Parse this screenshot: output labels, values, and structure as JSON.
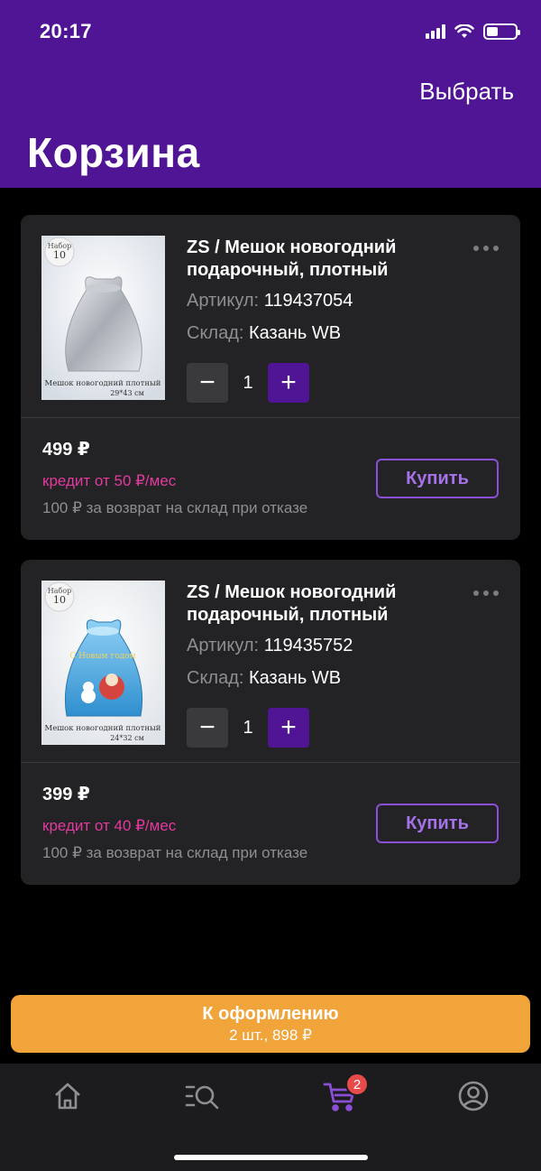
{
  "status": {
    "time": "20:17"
  },
  "header": {
    "action": "Выбрать",
    "title": "Корзина"
  },
  "products": [
    {
      "title": "ZS / Мешок новогодний подарочный, плотный",
      "article_label": "Артикул:",
      "article": "119437054",
      "warehouse_label": "Склад:",
      "warehouse": "Казань WB",
      "quantity": "1",
      "price": "499 ₽",
      "credit": "кредит от 50 ₽/мес",
      "refund": "100 ₽ за возврат на склад при отказе",
      "buy_label": "Купить",
      "image": {
        "badge": "Набор 10 штук",
        "caption": "Мешок новогодний плотный",
        "size": "29*43 см",
        "color": "#b9bec6"
      }
    },
    {
      "title": "ZS / Мешок новогодний подарочный, плотный",
      "article_label": "Артикул:",
      "article": "119435752",
      "warehouse_label": "Склад:",
      "warehouse": "Казань WB",
      "quantity": "1",
      "price": "399 ₽",
      "credit": "кредит от 40 ₽/мес",
      "refund": "100 ₽ за возврат на склад при отказе",
      "buy_label": "Купить",
      "image": {
        "badge": "Набор 10 штук",
        "caption": "Мешок новогодний плотный",
        "size": "24*32 см",
        "color": "#5fb2e6"
      }
    }
  ],
  "checkout": {
    "label": "К оформлению",
    "summary": "2 шт., 898 ₽"
  },
  "tabbar": {
    "items": [
      {
        "name": "home",
        "icon": "home-icon",
        "active": false
      },
      {
        "name": "catalog",
        "icon": "search-list-icon",
        "active": false
      },
      {
        "name": "cart",
        "icon": "cart-icon",
        "active": true,
        "badge": "2"
      },
      {
        "name": "profile",
        "icon": "profile-icon",
        "active": false
      }
    ]
  },
  "colors": {
    "brand": "#4f1594",
    "accent": "#8a4fd6",
    "credit": "#e23a9d",
    "checkout": "#f0a43a",
    "badge": "#e84a4a"
  }
}
